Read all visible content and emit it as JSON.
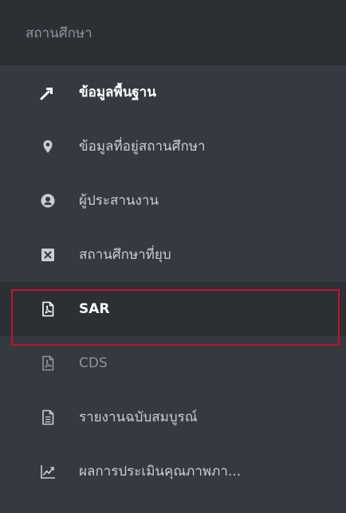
{
  "section": {
    "title": "สถานศึกษา"
  },
  "menu": {
    "items": [
      {
        "label": "ข้อมูลพื้นฐาน",
        "icon": "hammer-icon"
      },
      {
        "label": "ข้อมูลที่อยู่สถานศึกษา",
        "icon": "map-marker-icon"
      },
      {
        "label": "ผู้ประสานงาน",
        "icon": "user-circle-icon"
      },
      {
        "label": "สถานศึกษาที่ยุบ",
        "icon": "close-box-icon"
      },
      {
        "label": "SAR",
        "icon": "pdf-file-icon"
      },
      {
        "label": "CDS",
        "icon": "pdf-file-icon"
      },
      {
        "label": "รายงานฉบับสมบูรณ์",
        "icon": "document-icon"
      },
      {
        "label": "ผลการประเมินคุณภาพภา...",
        "icon": "line-chart-icon"
      }
    ]
  },
  "colors": {
    "sidebar_bg": "#343a40",
    "header_bg": "#2b3035",
    "highlight": "#c8102e"
  }
}
